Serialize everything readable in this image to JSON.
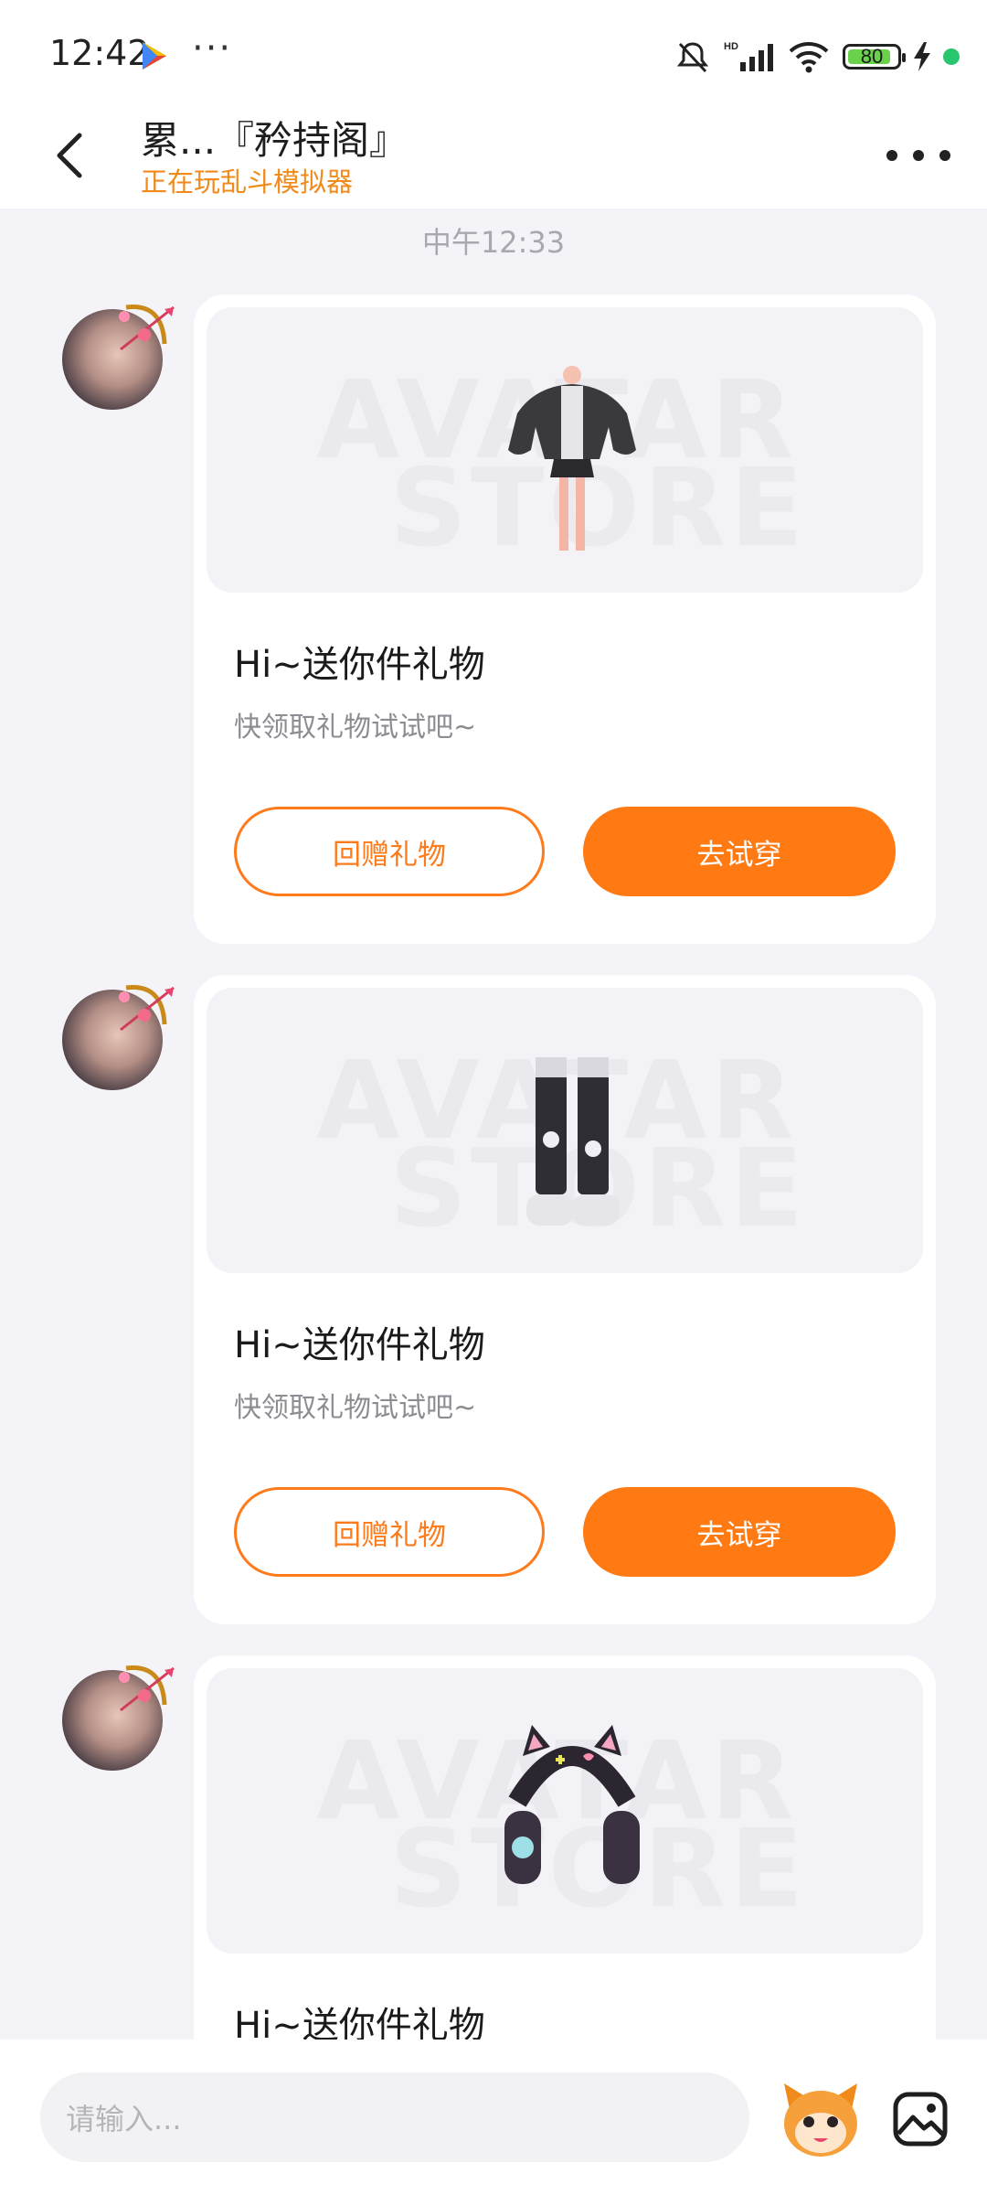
{
  "status_bar": {
    "time": "12:42",
    "battery": "80",
    "icons": [
      "play-store-icon",
      "more-dots-icon",
      "mute-icon",
      "hd-signal-icon",
      "wifi-icon",
      "battery-icon",
      "charging-icon"
    ]
  },
  "header": {
    "title": "累...『矜持阁』",
    "subtitle": "正在玩乱斗模拟器"
  },
  "chat": {
    "timestamp": "中午12:33",
    "watermark_line1": "AVATAR",
    "watermark_line2": "STORE",
    "messages": [
      {
        "item": "jacket-outfit",
        "title": "Hi~送你件礼物",
        "subtitle": "快领取礼物试试吧~",
        "return_gift_label": "回赠礼物",
        "try_on_label": "去试穿"
      },
      {
        "item": "boots",
        "title": "Hi~送你件礼物",
        "subtitle": "快领取礼物试试吧~",
        "return_gift_label": "回赠礼物",
        "try_on_label": "去试穿"
      },
      {
        "item": "cat-ear-headphones",
        "title": "Hi~送你件礼物"
      }
    ]
  },
  "input_bar": {
    "placeholder": "请输入..."
  },
  "colors": {
    "accent": "#ff7a13",
    "subtitle_orange": "#f08a1a",
    "background": "#f4f4f8"
  }
}
